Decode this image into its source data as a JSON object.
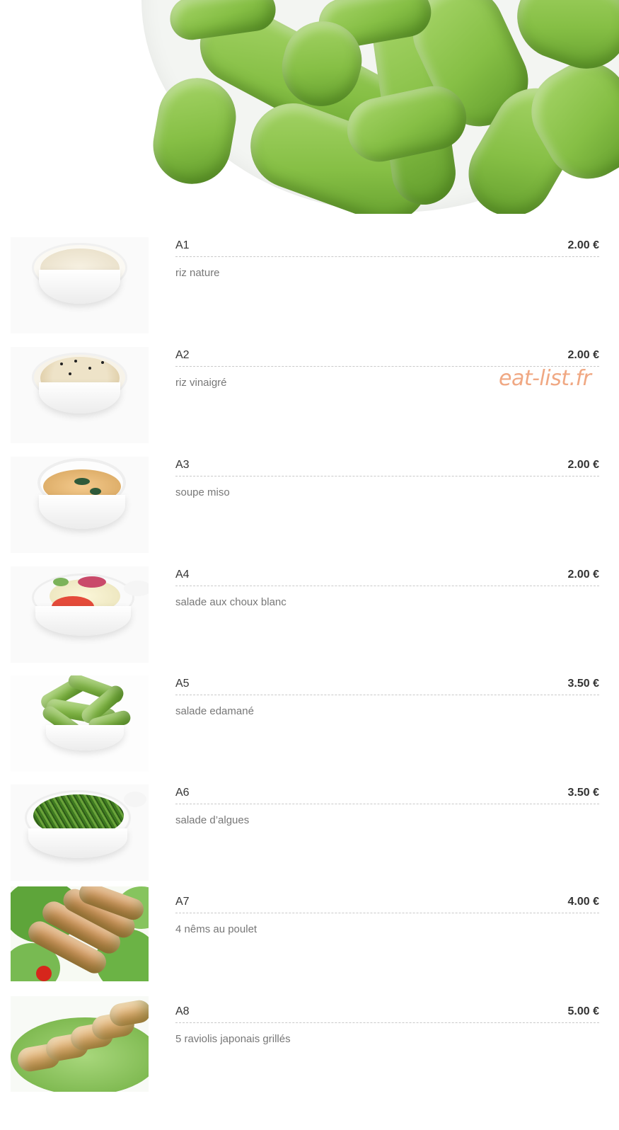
{
  "hero": {
    "image": "edamame-bowl-photo"
  },
  "watermark": "eat-list.fr",
  "items": [
    {
      "code": "A1",
      "price": "2.00 €",
      "desc": "riz nature",
      "image": "plain-rice-bowl"
    },
    {
      "code": "A2",
      "price": "2.00 €",
      "desc": "riz vinaigré",
      "image": "vinegared-rice-bowl"
    },
    {
      "code": "A3",
      "price": "2.00 €",
      "desc": "soupe miso",
      "image": "miso-soup-bowl"
    },
    {
      "code": "A4",
      "price": "2.00 €",
      "desc": "salade aux choux blanc",
      "image": "cabbage-salad-bowl"
    },
    {
      "code": "A5",
      "price": "3.50 €",
      "desc": "salade edamané",
      "image": "edamame-salad-bowl"
    },
    {
      "code": "A6",
      "price": "3.50 €",
      "desc": "salade d’algues",
      "image": "seaweed-salad-bowl"
    },
    {
      "code": "A7",
      "price": "4.00 €",
      "desc": "4 nêms au poulet",
      "image": "chicken-spring-rolls"
    },
    {
      "code": "A8",
      "price": "5.00 €",
      "desc": "5 raviolis japonais grillés",
      "image": "grilled-gyoza"
    }
  ]
}
